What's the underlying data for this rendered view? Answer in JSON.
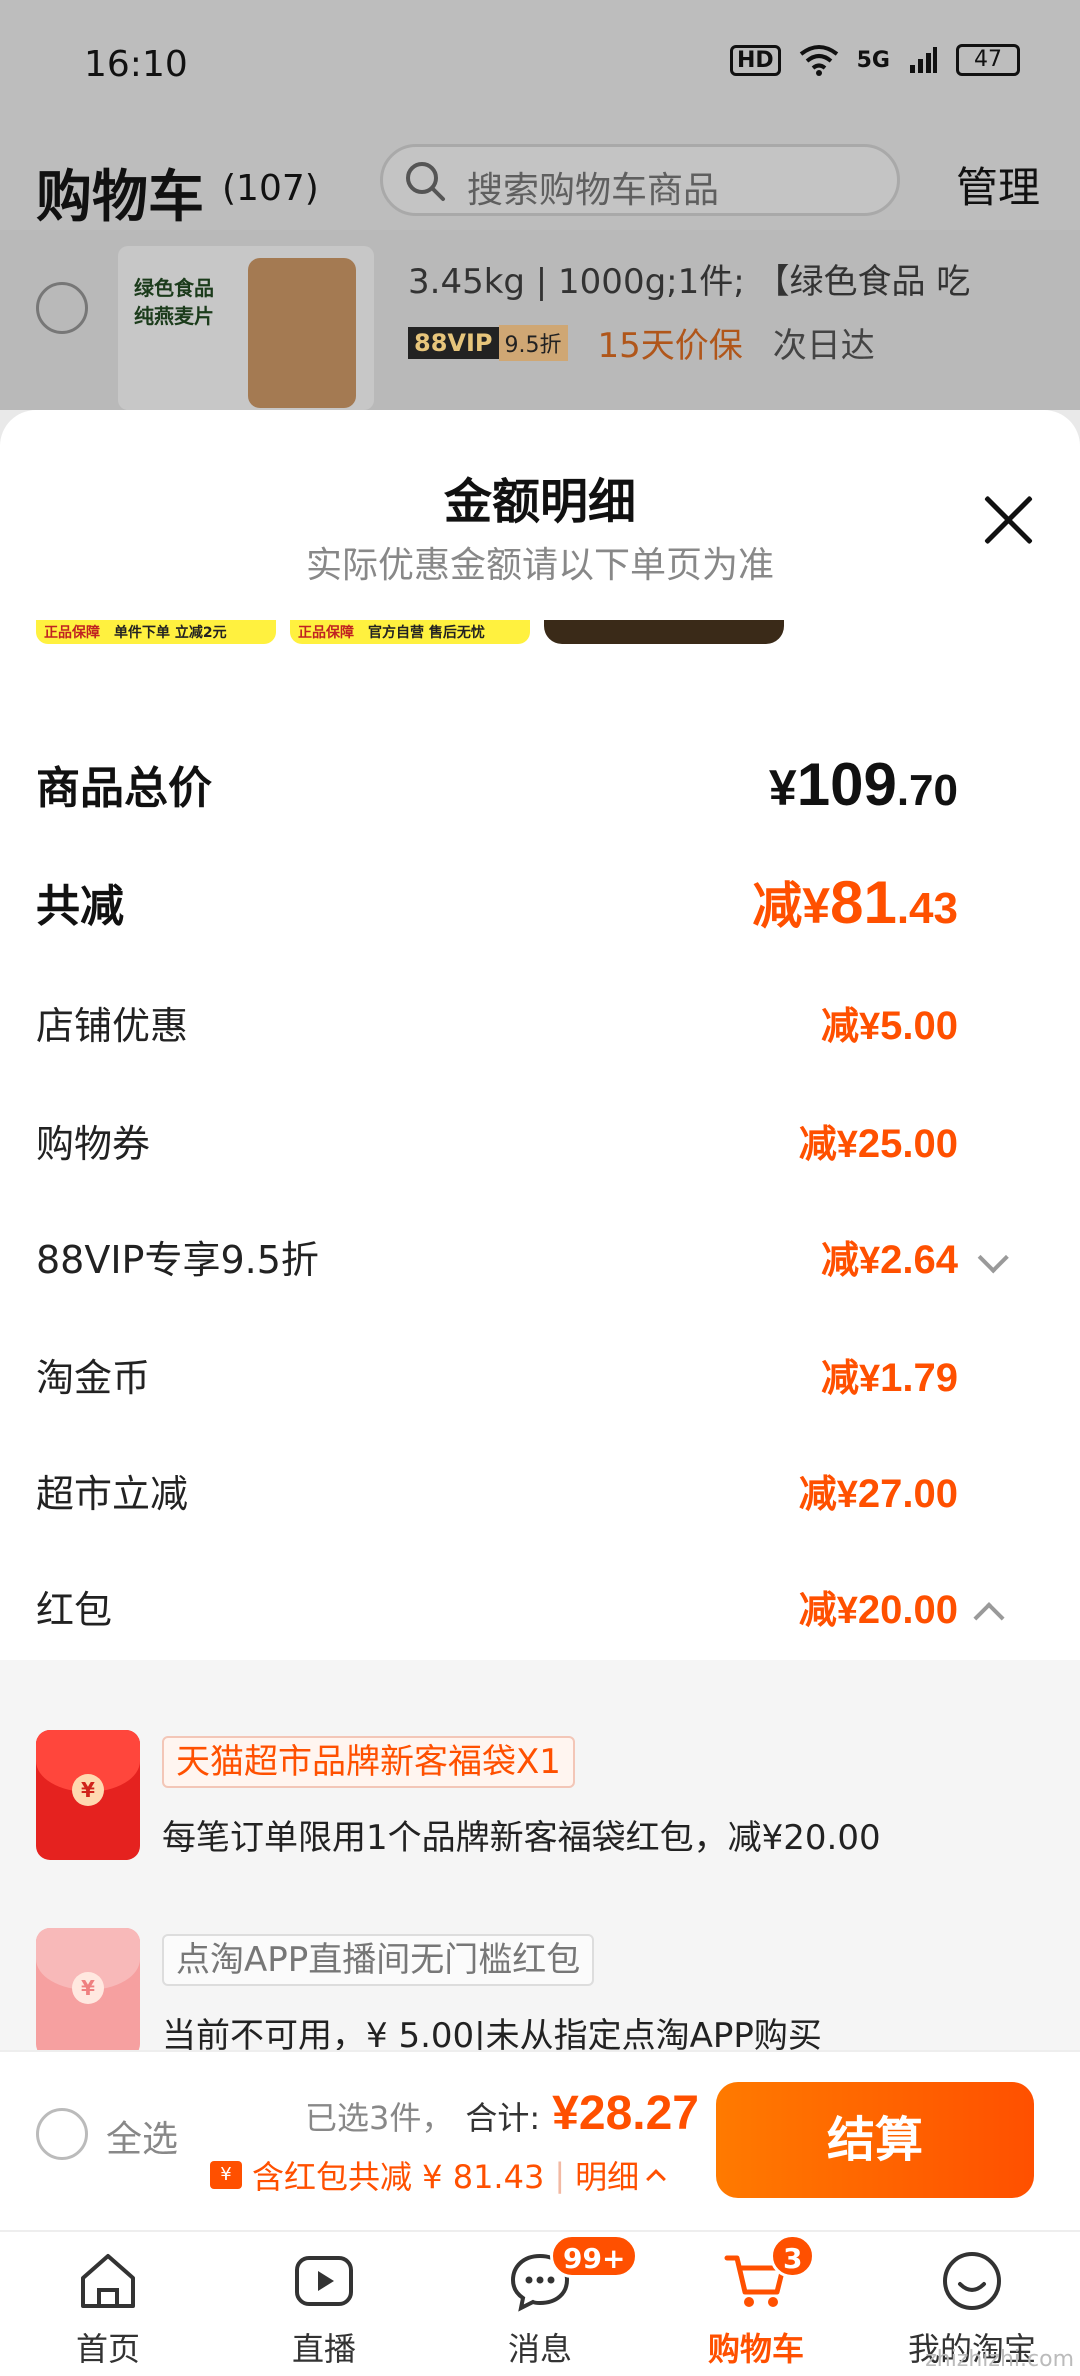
{
  "status": {
    "time": "16:10",
    "hd": "HD",
    "network": "5G",
    "battery": "47"
  },
  "cart": {
    "title": "购物车",
    "count": "(107)",
    "search_placeholder": "搜索购物车商品",
    "manage": "管理",
    "item": {
      "thumb_line1": "绿色食品",
      "thumb_line2": "纯燕麦片",
      "spec": "3.45kg | 1000g;1件; 【绿色食品 吃",
      "vip_tag": "88VIP",
      "vip_discount": "9.5折",
      "price_protect": "15天价保",
      "delivery": "次日达"
    }
  },
  "sheet": {
    "title": "金额明细",
    "subtitle": "实际优惠金额请以下单页为准",
    "promo_chips": [
      {
        "left": "正品保障",
        "right": "单件下单 立减2元"
      },
      {
        "left": "正品保障",
        "right": "官方自营 售后无忧"
      }
    ],
    "rows": [
      {
        "label": "商品总价",
        "prefix": "¥",
        "int": "109",
        "dec": ".70",
        "type": "total"
      },
      {
        "label": "共减",
        "prefix": "减¥",
        "int": "81",
        "dec": ".43",
        "type": "discount-total"
      },
      {
        "label": "店铺优惠",
        "prefix": "减¥",
        "int": "5",
        "dec": ".00"
      },
      {
        "label": "购物券",
        "prefix": "减¥",
        "int": "25",
        "dec": ".00"
      },
      {
        "label": "88VIP专享9.5折",
        "prefix": "减¥",
        "int": "2",
        "dec": ".64",
        "chevron": "down"
      },
      {
        "label": "淘金币",
        "prefix": "减¥",
        "int": "1",
        "dec": ".79"
      },
      {
        "label": "超市立减",
        "prefix": "减¥",
        "int": "27",
        "dec": ".00"
      },
      {
        "label": "红包",
        "prefix": "减¥",
        "int": "20",
        "dec": ".00",
        "chevron": "up"
      }
    ],
    "coupons": [
      {
        "tag": "天猫超市品牌新客福袋X1",
        "desc": "每笔订单限用1个品牌新客福袋红包，减¥20.00",
        "seal": "¥"
      },
      {
        "tag": "点淘APP直播间无门槛红包",
        "desc": "当前不可用，¥ 5.00|未从指定点淘APP购买",
        "seal": "¥"
      }
    ]
  },
  "checkout": {
    "select_all": "全选",
    "selected_count": "已选3件，",
    "total_label": "合计:",
    "total_amount": "¥28.27",
    "savings_text": "含红包共减 ¥ 81.43",
    "detail_label": "明细",
    "pay_button": "结算"
  },
  "tabs": [
    {
      "label": "首页",
      "icon": "home-icon"
    },
    {
      "label": "直播",
      "icon": "live-icon"
    },
    {
      "label": "消息",
      "icon": "message-icon",
      "badge": "99+"
    },
    {
      "label": "购物车",
      "icon": "cart-icon",
      "badge": "3",
      "active": true
    },
    {
      "label": "我的淘宝",
      "icon": "profile-icon"
    }
  ],
  "watermark": "zhizhizhi.com",
  "colors": {
    "accent": "#ff5000",
    "overlay": "#bdbdbd",
    "coupon_red": "#e5221f"
  }
}
